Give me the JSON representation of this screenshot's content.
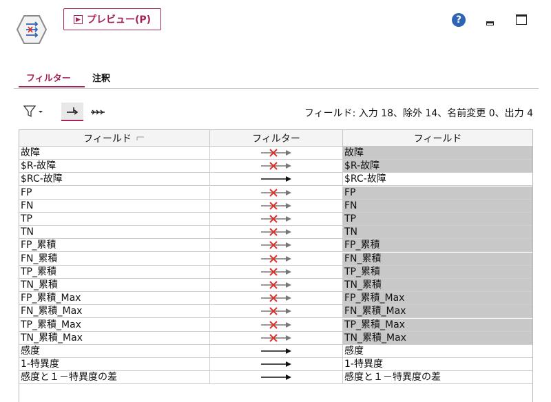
{
  "toolbar": {
    "preview_label": "プレビュー(P)",
    "help_label": "?"
  },
  "tabs": [
    {
      "label": "フィルター",
      "active": true
    },
    {
      "label": "注釈",
      "active": false
    }
  ],
  "summary": "フィールド: 入力 18、除外 14、名前変更 0、出力 4",
  "table": {
    "headers": [
      "フィールド",
      "フィルター",
      "フィールド"
    ],
    "rows": [
      {
        "in": "故障",
        "out": "故障",
        "excluded": true
      },
      {
        "in": "$R-故障",
        "out": "$R-故障",
        "excluded": true
      },
      {
        "in": "$RC-故障",
        "out": "$RC-故障",
        "excluded": false
      },
      {
        "in": "FP",
        "out": "FP",
        "excluded": true
      },
      {
        "in": "FN",
        "out": "FN",
        "excluded": true
      },
      {
        "in": "TP",
        "out": "TP",
        "excluded": true
      },
      {
        "in": "TN",
        "out": "TN",
        "excluded": true
      },
      {
        "in": "FP_累積",
        "out": "FP_累積",
        "excluded": true
      },
      {
        "in": "FN_累積",
        "out": "FN_累積",
        "excluded": true
      },
      {
        "in": "TP_累積",
        "out": "TP_累積",
        "excluded": true
      },
      {
        "in": "TN_累積",
        "out": "TN_累積",
        "excluded": true
      },
      {
        "in": "FP_累積_Max",
        "out": "FP_累積_Max",
        "excluded": true
      },
      {
        "in": "FN_累積_Max",
        "out": "FN_累積_Max",
        "excluded": true
      },
      {
        "in": "TP_累積_Max",
        "out": "TP_累積_Max",
        "excluded": true
      },
      {
        "in": "TN_累積_Max",
        "out": "TN_累積_Max",
        "excluded": true
      },
      {
        "in": "感度",
        "out": "感度",
        "excluded": false
      },
      {
        "in": "1-特異度",
        "out": "1-特異度",
        "excluded": false
      },
      {
        "in": "感度と１－特異度の差",
        "out": "感度と１－特異度の差",
        "excluded": false
      }
    ]
  },
  "colors": {
    "accent": "#a4245a",
    "excluded_bg": "#c8c8c8",
    "exclude_x": "#e0312a",
    "help_blue": "#2f64b4"
  }
}
